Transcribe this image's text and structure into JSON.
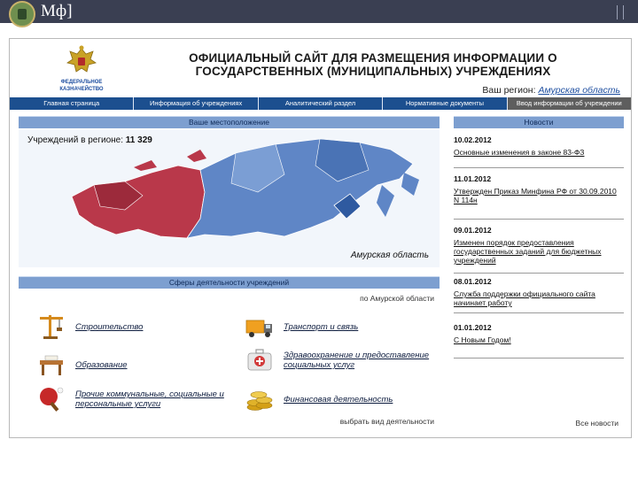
{
  "topbar": {
    "brand": "Мф]"
  },
  "header": {
    "logo_caption_1": "ФЕДЕРАЛЬНОЕ",
    "logo_caption_2": "КАЗНАЧЕЙСТВО",
    "title_line_1": "ОФИЦИАЛЬНЫЙ САЙТ ДЛЯ РАЗМЕЩЕНИЯ ИНФОРМАЦИИ О",
    "title_line_2": "ГОСУДАРСТВЕННЫХ (МУНИЦИПАЛЬНЫХ) УЧРЕЖДЕНИЯХ",
    "region_prefix": "Ваш регион:",
    "region_value": "Амурская область"
  },
  "nav": {
    "items": [
      "Главная страница",
      "Информация об учреждениях",
      "Аналитический раздел",
      "Нормативные документы",
      "Ввод информации об учреждении"
    ]
  },
  "location": {
    "heading": "Ваше местоположение",
    "count_label": "Учреждений в регионе:",
    "count_value": "11 329",
    "map_region_label": "Амурская область"
  },
  "spheres": {
    "heading": "Сферы деятельности учреждений",
    "region_note": "по Амурской области",
    "items": [
      {
        "label": "Строительство",
        "icon": "crane-icon"
      },
      {
        "label": "Транспорт и связь",
        "icon": "truck-icon"
      },
      {
        "label": "Образование",
        "icon": "desk-icon"
      },
      {
        "label": "Здравоохранение и предоставление социальных услуг",
        "icon": "medical-case-icon"
      },
      {
        "label": "Прочие коммунальные, социальные и персональные услуги",
        "icon": "ping-pong-icon"
      },
      {
        "label": "Финансовая деятельность",
        "icon": "coins-icon"
      }
    ],
    "choose_link": "выбрать вид деятельности"
  },
  "news": {
    "heading": "Новости",
    "items": [
      {
        "date": "10.02.2012",
        "title": "Основные изменения в законе 83-ФЗ"
      },
      {
        "date": "11.01.2012",
        "title": "Утвержден Приказ Минфина РФ от 30.09.2010 N 114н"
      },
      {
        "date": "09.01.2012",
        "title": "Изменен порядок предоставления государственных заданий для бюджетных учреждений"
      },
      {
        "date": "08.01.2012",
        "title": "Служба поддержки официального сайта начинает работу"
      },
      {
        "date": "01.01.2012",
        "title": "С Новым Годом!"
      }
    ],
    "all_news": "Все новости"
  },
  "colors": {
    "nav_bg": "#1c4f8f",
    "panel_head_bg": "#7d9fd0",
    "map_west": "#b9384a",
    "map_east": "#5f86c6",
    "topbar_bg": "#3a3f52"
  }
}
